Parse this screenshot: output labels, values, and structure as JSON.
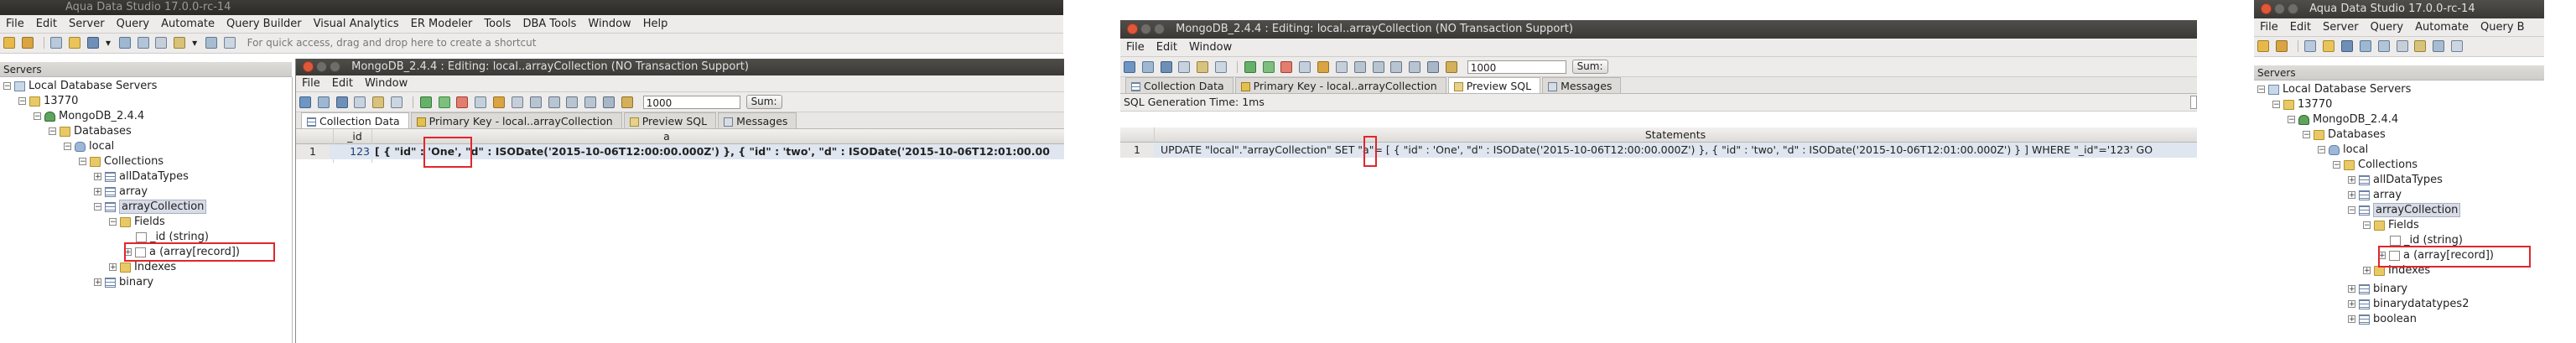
{
  "left": {
    "app_title": "Aqua Data Studio 17.0.0-rc-14",
    "menu": [
      "File",
      "Edit",
      "Server",
      "Query",
      "Automate",
      "Query Builder",
      "Visual Analytics",
      "ER Modeler",
      "Tools",
      "DBA Tools",
      "Window",
      "Help"
    ],
    "toolbar_hint": "For quick access, drag and drop here to create a shortcut",
    "servers_label": "Servers",
    "tree": [
      {
        "label": "Local Database Servers",
        "icon": "server-group-icon"
      },
      {
        "label": "13770",
        "icon": "folder-icon"
      },
      {
        "label": "MongoDB_2.4.4",
        "icon": "mongodb-icon"
      },
      {
        "label": "Databases",
        "icon": "folder-icon"
      },
      {
        "label": "local",
        "icon": "database-icon"
      },
      {
        "label": "Collections",
        "icon": "folder-icon"
      },
      {
        "label": "allDataTypes",
        "icon": "table-icon"
      },
      {
        "label": "array",
        "icon": "table-icon"
      },
      {
        "label": "arrayCollection",
        "icon": "table-icon"
      },
      {
        "label": "Fields",
        "icon": "folder-icon"
      },
      {
        "label": "_id (string)",
        "icon": "field-icon"
      },
      {
        "label": "a (array[record])",
        "icon": "field-icon"
      },
      {
        "label": "Indexes",
        "icon": "folder-icon"
      },
      {
        "label": "binary",
        "icon": "table-icon"
      }
    ],
    "editor": {
      "title": "MongoDB_2.4.4 : Editing: local..arrayCollection (NO Transaction Support)",
      "menu": [
        "File",
        "Edit",
        "Window"
      ],
      "limit_value": "1000",
      "sum_label": "Sum:",
      "tabs": [
        "Collection Data",
        "Primary Key - local..arrayCollection",
        "Preview SQL",
        "Messages"
      ],
      "columns": [
        "_id",
        "a"
      ],
      "row": {
        "num": "1",
        "id": "123",
        "a": "[ { \"id\" : 'One', \"d\" : ISODate('2015-10-06T12:00:00.000Z') }, { \"id\" : 'two', \"d\" : ISODate('2015-10-06T12:01:00.00"
      }
    }
  },
  "middle": {
    "title": "MongoDB_2.4.4 : Editing: local..arrayCollection (NO Transaction Support)",
    "menu": [
      "File",
      "Edit",
      "Window"
    ],
    "limit_value": "1000",
    "sum_label": "Sum:",
    "tabs": [
      "Collection Data",
      "Primary Key - local..arrayCollection",
      "Preview SQL",
      "Messages"
    ],
    "generation_time": "SQL Generation Time: 1ms",
    "column": "Statements",
    "row": {
      "num": "1",
      "statement": "UPDATE \"local\".\"arrayCollection\" SET \"a\"= [ { \"id\" : 'One', \"d\" : ISODate('2015-10-06T12:00:00.000Z') }, { \"id\" : 'two', \"d\" : ISODate('2015-10-06T12:01:00.000Z') } ] WHERE \"_id\"='123' GO"
    }
  },
  "right": {
    "app_title": "Aqua Data Studio 17.0.0-rc-14",
    "menu": [
      "File",
      "Edit",
      "Server",
      "Query",
      "Automate",
      "Query B"
    ],
    "servers_label": "Servers",
    "tree": [
      {
        "label": "Local Database Servers",
        "icon": "server-group-icon"
      },
      {
        "label": "13770",
        "icon": "folder-icon"
      },
      {
        "label": "MongoDB_2.4.4",
        "icon": "mongodb-icon"
      },
      {
        "label": "Databases",
        "icon": "folder-icon"
      },
      {
        "label": "local",
        "icon": "database-icon"
      },
      {
        "label": "Collections",
        "icon": "folder-icon"
      },
      {
        "label": "allDataTypes",
        "icon": "table-icon"
      },
      {
        "label": "array",
        "icon": "table-icon"
      },
      {
        "label": "arrayCollection",
        "icon": "table-icon"
      },
      {
        "label": "Fields",
        "icon": "folder-icon"
      },
      {
        "label": "_id (string)",
        "icon": "field-icon"
      },
      {
        "label": "a (array[record])",
        "icon": "field-icon"
      },
      {
        "label": "Indexes",
        "icon": "folder-icon"
      },
      {
        "label": "binary",
        "icon": "table-icon"
      },
      {
        "label": "binarydatatypes2",
        "icon": "table-icon"
      },
      {
        "label": "boolean",
        "icon": "table-icon"
      }
    ]
  }
}
